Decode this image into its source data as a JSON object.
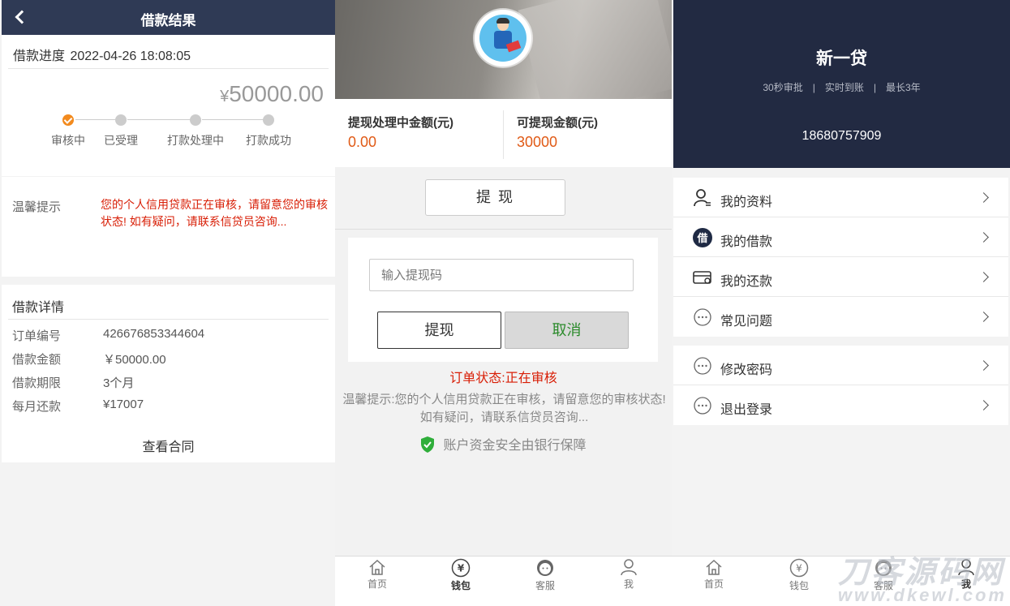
{
  "loan_result": {
    "header_title": "借款结果",
    "progress_label": "借款进度",
    "progress_date": "2022-04-26 18:08:05",
    "amount_symbol": "¥",
    "amount_value": "50000.00",
    "steps": [
      {
        "label": "审核中",
        "active": true
      },
      {
        "label": "已受理",
        "active": false
      },
      {
        "label": "打款处理中",
        "active": false
      },
      {
        "label": "打款成功",
        "active": false
      }
    ],
    "tip_label": "温馨提示",
    "tip_text": "您的个人信用贷款正在审核，请留意您的审核状态! 如有疑问，请联系信贷员咨询...",
    "detail_title": "借款详情",
    "details": [
      {
        "key": "订单编号",
        "value": "426676853344604"
      },
      {
        "key": "借款金额",
        "value": "￥50000.00"
      },
      {
        "key": "借款期限",
        "value": "3个月"
      },
      {
        "key": "每月还款",
        "value": "¥17007"
      }
    ],
    "contract_link": "查看合同"
  },
  "wallet": {
    "processing_label": "提现处理中金额(元)",
    "processing_value": "0.00",
    "available_label": "可提现金额(元)",
    "available_value": "30000",
    "withdraw_button": "提 现",
    "code_placeholder": "输入提现码",
    "confirm_button": "提现",
    "cancel_button": "取消",
    "order_status": "订单状态:正在审核",
    "tip": "温馨提示:您的个人信用贷款正在审核，请留意您的审核状态! 如有疑问，请联系信贷员咨询...",
    "safety_note": "账户资金安全由银行保障",
    "tabs": [
      {
        "label": "首页",
        "icon": "home-icon"
      },
      {
        "label": "钱包",
        "icon": "wallet-icon",
        "active": true
      },
      {
        "label": "客服",
        "icon": "service-icon"
      },
      {
        "label": "我",
        "icon": "user-icon"
      }
    ]
  },
  "profile": {
    "app_name": "新一贷",
    "slogan": [
      "30秒审批",
      "实时到账",
      "最长3年"
    ],
    "slogan_sep": "|",
    "phone": "18680757909",
    "menu_group_1": [
      {
        "label": "我的资料",
        "icon": "profile-icon"
      },
      {
        "label": "我的借款",
        "icon": "loan-icon"
      },
      {
        "label": "我的还款",
        "icon": "card-icon"
      },
      {
        "label": "常见问题",
        "icon": "more-icon"
      }
    ],
    "menu_group_2": [
      {
        "label": "修改密码",
        "icon": "more-icon"
      },
      {
        "label": "退出登录",
        "icon": "more-icon"
      }
    ],
    "tabs": [
      {
        "label": "首页",
        "icon": "home-icon"
      },
      {
        "label": "钱包",
        "icon": "wallet-icon"
      },
      {
        "label": "客服",
        "icon": "service-icon"
      },
      {
        "label": "我",
        "icon": "user-icon",
        "active": true
      }
    ],
    "watermark": "刀客源码网",
    "watermark_url": "www.dkewl.com"
  },
  "colors": {
    "header_navy": "#2f3a55",
    "profile_navy": "#222a42",
    "accent_orange": "#f28a1e",
    "warning_red": "#d81e06",
    "amount_orange": "#e05a16",
    "cancel_green": "#2a8a2a"
  }
}
